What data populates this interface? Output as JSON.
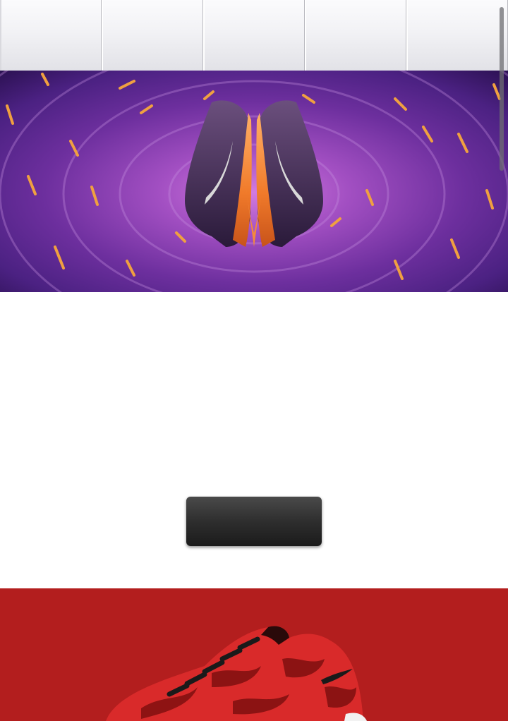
{
  "nav": {
    "tabs": [
      {
        "label": ""
      },
      {
        "label": ""
      },
      {
        "label": ""
      },
      {
        "label": ""
      },
      {
        "label": ""
      }
    ]
  },
  "hero": {
    "image": "purple-knit-tunnel-sneakers",
    "colors": {
      "base": "#4a1f7e",
      "accent": "#f07a2a"
    }
  },
  "cta": {
    "label": ""
  },
  "product_banner": {
    "image": "red-sneaker",
    "colors": {
      "background": "#b31e1e"
    }
  }
}
